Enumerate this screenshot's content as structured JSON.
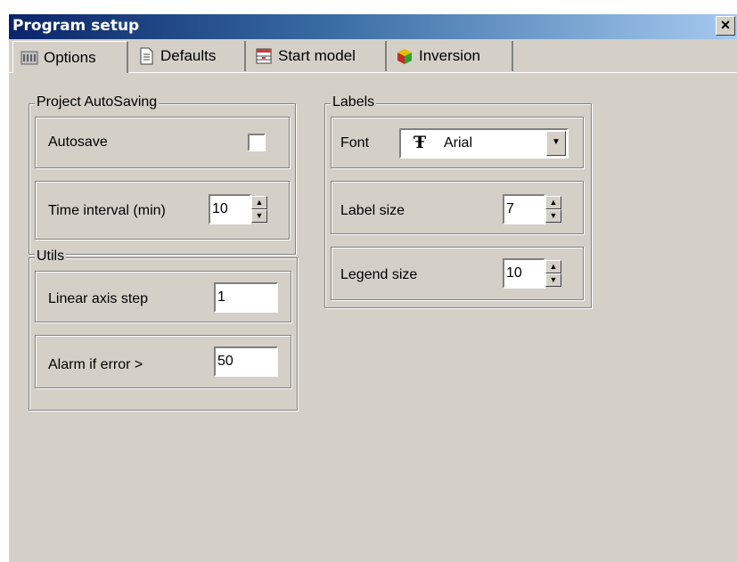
{
  "window": {
    "title": "Program setup",
    "close_glyph": "×"
  },
  "tabs": [
    {
      "label": "Options",
      "icon": "options-icon"
    },
    {
      "label": "Defaults",
      "icon": "document-icon"
    },
    {
      "label": "Start model",
      "icon": "model-icon"
    },
    {
      "label": "Inversion",
      "icon": "cube-icon"
    }
  ],
  "autosaving": {
    "title": "Project AutoSaving",
    "autosave_label": "Autosave",
    "autosave_checked": false,
    "interval_label": "Time interval (min)",
    "interval_value": "10"
  },
  "utils": {
    "title": "Utils",
    "axis_step_label": "Linear axis step",
    "axis_step_value": "1",
    "alarm_label": "Alarm if error >",
    "alarm_value": "50"
  },
  "labels": {
    "title": "Labels",
    "font_label": "Font",
    "font_value": "Arial",
    "font_icon_glyph": "Ŧ",
    "label_size_label": "Label size",
    "label_size_value": "7",
    "legend_size_label": "Legend size",
    "legend_size_value": "10"
  },
  "glyphs": {
    "up": "▲",
    "down": "▼"
  }
}
